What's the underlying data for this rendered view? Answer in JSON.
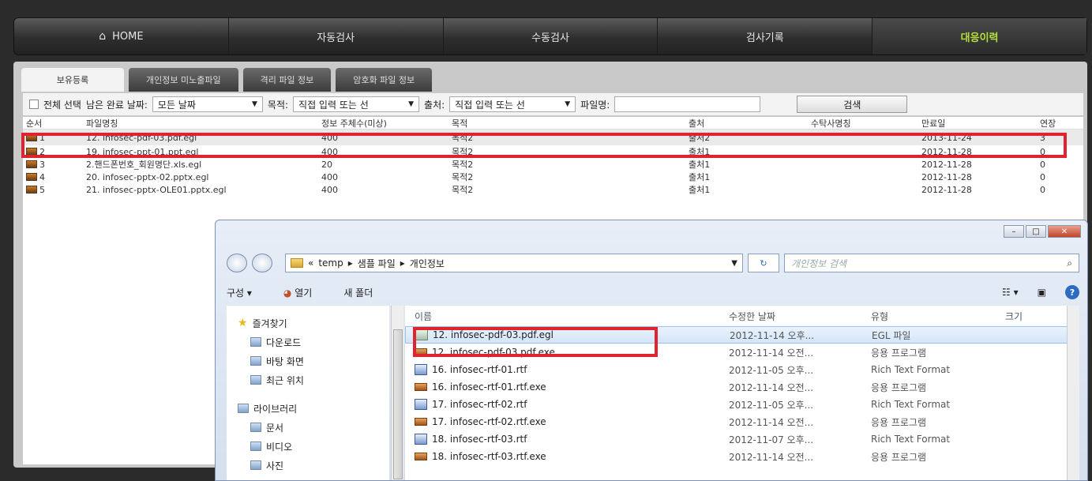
{
  "topnav": {
    "items": [
      {
        "label": "HOME",
        "icon": "home-icon"
      },
      {
        "label": "자동검사"
      },
      {
        "label": "수동검사"
      },
      {
        "label": "검사기록"
      },
      {
        "label": "대응이력",
        "active": true
      }
    ]
  },
  "tabs": [
    "보유등록",
    "개인정보 미노출파일",
    "격리 파일 정보",
    "암호화 파일 정보"
  ],
  "filter": {
    "select_all_label": "전체 선택",
    "date_label": "남은 완료 날짜:",
    "date_value": "모든 날짜",
    "purpose_label": "목적:",
    "purpose_value": "직접 입력 또는 선",
    "source_label": "출처:",
    "source_value": "직접 입력 또는 선",
    "filename_label": "파일명:",
    "search_button": "검색"
  },
  "grid": {
    "columns": [
      "순서",
      "파일명칭",
      "정보 주체수(미상)",
      "목적",
      "출처",
      "수탁사명칭",
      "만료일",
      "연장"
    ],
    "rows": [
      {
        "no": "1",
        "file": "12. infosec-pdf-03.pdf.egl",
        "count": "400",
        "purpose": "목적2",
        "source": "출처2",
        "vendor": "",
        "expiry": "2013-11-24",
        "ext": "3"
      },
      {
        "no": "2",
        "file": "19. infosec-ppt-01.ppt.egl",
        "count": "400",
        "purpose": "목적2",
        "source": "출처1",
        "vendor": "",
        "expiry": "2012-11-28",
        "ext": "0"
      },
      {
        "no": "3",
        "file": "2.핸드폰번호_회원명단.xls.egl",
        "count": "20",
        "purpose": "목적2",
        "source": "출처1",
        "vendor": "",
        "expiry": "2012-11-28",
        "ext": "0"
      },
      {
        "no": "4",
        "file": "20. infosec-pptx-02.pptx.egl",
        "count": "400",
        "purpose": "목적2",
        "source": "출처1",
        "vendor": "",
        "expiry": "2012-11-28",
        "ext": "0"
      },
      {
        "no": "5",
        "file": "21. infosec-pptx-OLE01.pptx.egl",
        "count": "400",
        "purpose": "목적2",
        "source": "출처1",
        "vendor": "",
        "expiry": "2012-11-28",
        "ext": "0"
      }
    ]
  },
  "explorer": {
    "path": [
      "temp",
      "샘플 파일",
      "개인정보"
    ],
    "path_prefix": "«",
    "search_placeholder": "개인정보 검색",
    "toolbar": {
      "organize": "구성 ▾",
      "open": "열기",
      "new_folder": "새 폴더"
    },
    "nav": [
      {
        "label": "즐겨찾기",
        "icon": "star-icon",
        "top": true
      },
      {
        "label": "다운로드",
        "icon": "download-folder-icon"
      },
      {
        "label": "바탕 화면",
        "icon": "desktop-icon"
      },
      {
        "label": "최근 위치",
        "icon": "recent-places-icon"
      },
      {
        "label": "라이브러리",
        "icon": "library-icon",
        "top": true
      },
      {
        "label": "문서",
        "icon": "documents-icon"
      },
      {
        "label": "비디오",
        "icon": "videos-icon"
      },
      {
        "label": "사진",
        "icon": "pictures-icon"
      }
    ],
    "columns": [
      "이름",
      "수정한 날짜",
      "유형",
      "크기"
    ],
    "files": [
      {
        "name": "12. infosec-pdf-03.pdf.egl",
        "date": "2012-11-14 오후...",
        "type": "EGL 파일",
        "icon": "egl-file-icon"
      },
      {
        "name": "12. infosec-pdf-03.pdf.exe",
        "date": "2012-11-14 오전...",
        "type": "응용 프로그램",
        "icon": "exe-file-icon"
      },
      {
        "name": "16. infosec-rtf-01.rtf",
        "date": "2012-11-05 오후...",
        "type": "Rich Text Format",
        "icon": "rtf-file-icon"
      },
      {
        "name": "16. infosec-rtf-01.rtf.exe",
        "date": "2012-11-14 오전...",
        "type": "응용 프로그램",
        "icon": "exe-file-icon"
      },
      {
        "name": "17. infosec-rtf-02.rtf",
        "date": "2012-11-05 오후...",
        "type": "Rich Text Format",
        "icon": "rtf-file-icon"
      },
      {
        "name": "17. infosec-rtf-02.rtf.exe",
        "date": "2012-11-14 오전...",
        "type": "응용 프로그램",
        "icon": "exe-file-icon"
      },
      {
        "name": "18. infosec-rtf-03.rtf",
        "date": "2012-11-07 오후...",
        "type": "Rich Text Format",
        "icon": "rtf-file-icon"
      },
      {
        "name": "18. infosec-rtf-03.rtf.exe",
        "date": "2012-11-14 오전...",
        "type": "응용 프로그램",
        "icon": "exe-file-icon"
      }
    ]
  },
  "colors": {
    "highlight": "#e0242f",
    "active_nav": "#b5e03a"
  }
}
